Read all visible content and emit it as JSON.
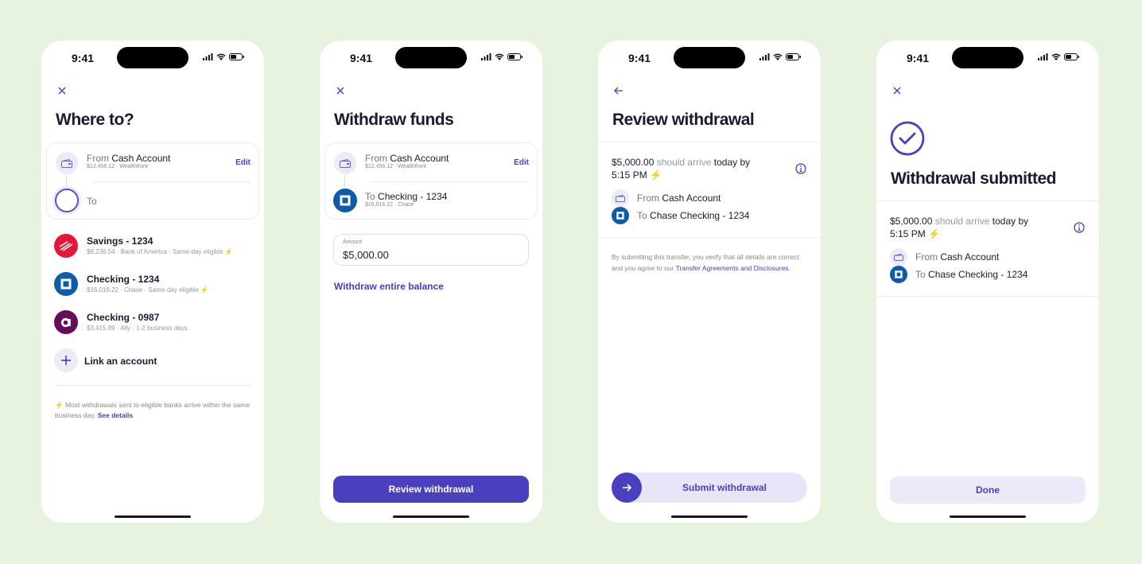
{
  "status_bar": {
    "time": "9:41"
  },
  "screen1": {
    "title": "Where to?",
    "from_prefix": "From",
    "from_account": "Cash Account",
    "from_detail": "$12,456.12 · Wealthfront",
    "edit_label": "Edit",
    "to_label": "To",
    "accounts": [
      {
        "name": "Savings - 1234",
        "detail": "$8,236.54 · Bank of America · Same-day eligible",
        "bank": "Bank of America",
        "color": "#e31837",
        "same_day": true
      },
      {
        "name": "Checking - 1234",
        "detail": "$16,016.22 · Chase · Same-day eligible",
        "bank": "Chase",
        "color": "#0e5ba8",
        "same_day": true
      },
      {
        "name": "Checking - 0987",
        "detail": "$3,415.89 · Ally · 1-2 business days",
        "bank": "Ally",
        "color": "#650c5a",
        "same_day": false
      }
    ],
    "link_account": "Link an account",
    "footnote": "Most withdrawals sent to eligible banks arrive within the same business day.",
    "see_details": "See details"
  },
  "screen2": {
    "title": "Withdraw funds",
    "from_prefix": "From",
    "from_account": "Cash Account",
    "from_detail": "$12,456.12 · Wealthfront",
    "edit_label": "Edit",
    "to_prefix": "To",
    "to_account": "Checking - 1234",
    "to_detail": "$16,016.22 · Chase",
    "amount_label": "Amount",
    "amount_value": "$5,000.00",
    "withdraw_all": "Withdraw entire balance",
    "cta": "Review withdrawal"
  },
  "screen3": {
    "title": "Review withdrawal",
    "amount": "$5,000.00",
    "should_arrive": "should arrive",
    "arrival": "today by",
    "arrival_time": "5:15 PM",
    "from_prefix": "From",
    "from_account": "Cash Account",
    "to_prefix": "To",
    "to_account": "Chase Checking - 1234",
    "disclaimer": "By submitting this transfer, you verify that all details are correct and you agree to our",
    "disclaimer_link": "Transfer Agreements and Disclosures",
    "cta": "Submit withdrawal"
  },
  "screen4": {
    "title": "Withdrawal submitted",
    "amount": "$5,000.00",
    "should_arrive": "should arrive",
    "arrival": "today by",
    "arrival_time": "5:15 PM",
    "from_prefix": "From",
    "from_account": "Cash Account",
    "to_prefix": "To",
    "to_account": "Chase Checking - 1234",
    "cta": "Done"
  },
  "colors": {
    "accent": "#4a3fbd",
    "accent_soft": "#e7e5f7",
    "background": "#e7f3df",
    "bolt": "#f5c33b"
  }
}
